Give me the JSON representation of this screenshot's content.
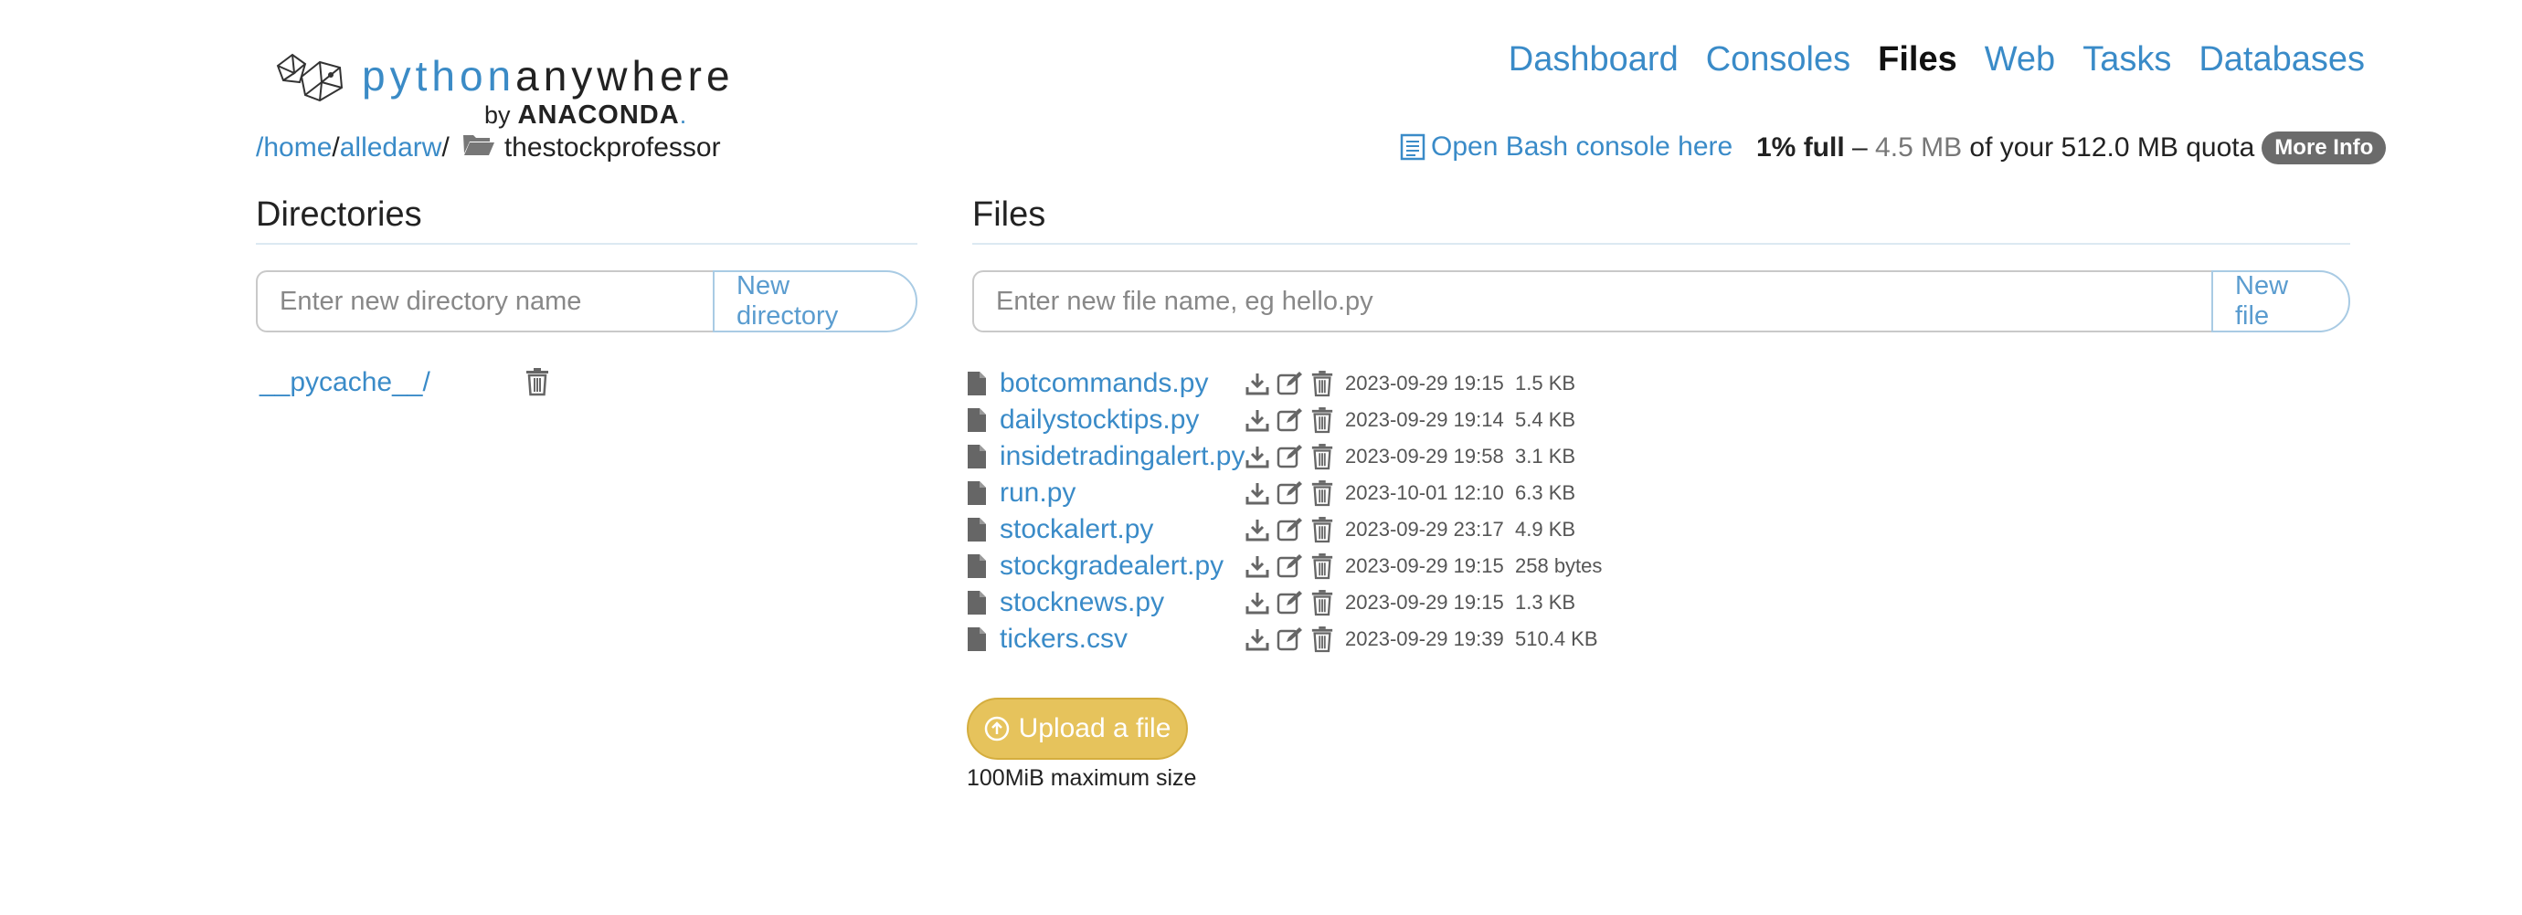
{
  "logo": {
    "python": "python",
    "anywhere": "anywhere",
    "by": "by",
    "brand": "ANACONDA",
    "dot": "."
  },
  "nav": [
    {
      "label": "Dashboard",
      "active": false
    },
    {
      "label": "Consoles",
      "active": false
    },
    {
      "label": "Files",
      "active": true
    },
    {
      "label": "Web",
      "active": false
    },
    {
      "label": "Tasks",
      "active": false
    },
    {
      "label": "Databases",
      "active": false
    }
  ],
  "breadcrumb": {
    "sep0": "/",
    "home": "home",
    "sep1": "/",
    "user": "alledarw",
    "sep2": "/",
    "current": "thestockprofessor"
  },
  "console_link": "Open Bash console here",
  "quota": {
    "full": "1% full",
    "dash": " – ",
    "used": "4.5 MB",
    "rest": " of your 512.0 MB quota",
    "more": "More Info"
  },
  "directories": {
    "title": "Directories",
    "input_placeholder": "Enter new directory name",
    "button": "New directory",
    "items": [
      {
        "name": "__pycache__/"
      }
    ]
  },
  "files": {
    "title": "Files",
    "input_placeholder": "Enter new file name, eg hello.py",
    "button": "New file",
    "items": [
      {
        "name": "botcommands.py",
        "date": "2023-09-29 19:15",
        "size": "1.5 KB"
      },
      {
        "name": "dailystocktips.py",
        "date": "2023-09-29 19:14",
        "size": "5.4 KB"
      },
      {
        "name": "insidetradingalert.py",
        "date": "2023-09-29 19:58",
        "size": "3.1 KB"
      },
      {
        "name": "run.py",
        "date": "2023-10-01 12:10",
        "size": "6.3 KB"
      },
      {
        "name": "stockalert.py",
        "date": "2023-09-29 23:17",
        "size": "4.9 KB"
      },
      {
        "name": "stockgradealert.py",
        "date": "2023-09-29 19:15",
        "size": "258 bytes"
      },
      {
        "name": "stocknews.py",
        "date": "2023-09-29 19:15",
        "size": "1.3 KB"
      },
      {
        "name": "tickers.csv",
        "date": "2023-09-29 19:39",
        "size": "510.4 KB"
      }
    ]
  },
  "upload": {
    "label": "Upload a file",
    "note": "100MiB maximum size"
  },
  "colors": {
    "link": "#3a8bc8",
    "upload": "#e6c35c",
    "badge": "#6b6b6b"
  },
  "icons": [
    "pythonanywhere-logo-icon",
    "folder-open-icon",
    "console-icon",
    "trash-icon",
    "file-icon",
    "download-icon",
    "edit-icon",
    "upload-icon"
  ]
}
